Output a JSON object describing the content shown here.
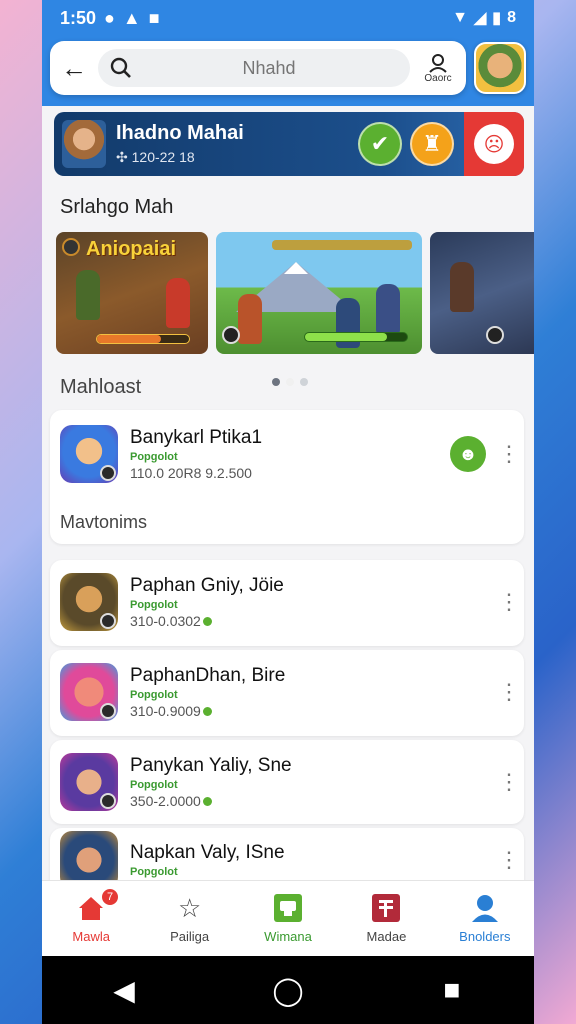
{
  "status": {
    "time": "1:50",
    "battery": "8"
  },
  "search": {
    "placeholder": "Nhahd",
    "profile_label": "Oaorc"
  },
  "banner": {
    "title": "Ihadno Mahai",
    "subtitle": "120-22 18"
  },
  "screenshots_section": {
    "title": "Srlahgo Mah"
  },
  "screenshots": [
    {
      "title": "Aniopaiai"
    },
    {
      "title": ""
    },
    {
      "title": ""
    }
  ],
  "featured_section": {
    "title": "Mahloast"
  },
  "featured_app": {
    "name": "Banykarl Ptika1",
    "category": "Popgolot",
    "meta": "110.0 20R8 9.2.500"
  },
  "more_section": {
    "title": "Mavtonims"
  },
  "apps": [
    {
      "name": "Paphan Gniy, Jöie",
      "category": "Popgolot",
      "meta": "310-0.0302"
    },
    {
      "name": "PaphanDhan, Bire",
      "category": "Popgolot",
      "meta": "310-0.9009"
    },
    {
      "name": "Panykan Yaliy, Sne",
      "category": "Popgolot",
      "meta": "350-2.0000"
    },
    {
      "name": "Napkan Valy, ISne",
      "category": "Popgolot",
      "meta": ""
    }
  ],
  "bottom_nav": [
    {
      "label": "Mawla",
      "color": "#e53935",
      "icon": "home-icon",
      "badge": "7"
    },
    {
      "label": "Pailiga",
      "color": "#444444",
      "icon": "star-icon"
    },
    {
      "label": "Wimana",
      "color": "#3a9a30",
      "icon": "games-icon"
    },
    {
      "label": "Madae",
      "color": "#444444",
      "icon": "library-icon"
    },
    {
      "label": "Bnolders",
      "color": "#2a7fd4",
      "icon": "profile-icon"
    }
  ]
}
